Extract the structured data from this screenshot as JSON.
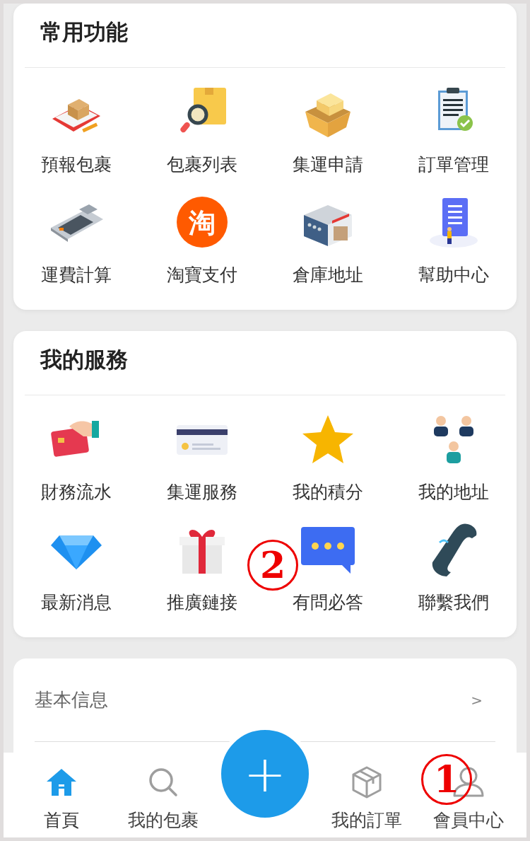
{
  "sections": [
    {
      "title": "常用功能",
      "items": [
        {
          "label": "預報包裹"
        },
        {
          "label": "包裹列表"
        },
        {
          "label": "集運申請"
        },
        {
          "label": "訂單管理"
        },
        {
          "label": "運費計算"
        },
        {
          "label": "淘寶支付"
        },
        {
          "label": "倉庫地址"
        },
        {
          "label": "幫助中心"
        }
      ]
    },
    {
      "title": "我的服務",
      "items": [
        {
          "label": "財務流水"
        },
        {
          "label": "集運服務"
        },
        {
          "label": "我的積分"
        },
        {
          "label": "我的地址"
        },
        {
          "label": "最新消息"
        },
        {
          "label": "推廣鏈接"
        },
        {
          "label": "有問必答"
        },
        {
          "label": "聯繫我們"
        }
      ]
    }
  ],
  "taobao_glyph": "淘",
  "list": [
    {
      "label": "基本信息",
      "arrow": ">"
    }
  ],
  "bottom_nav": [
    {
      "label": "首頁",
      "selected": true
    },
    {
      "label": "我的包裹",
      "selected": false
    },
    {
      "kind": "fab",
      "symbol": "+"
    },
    {
      "label": "我的訂單",
      "selected": false
    },
    {
      "label": "會員中心",
      "selected": false
    }
  ],
  "callouts": [
    {
      "label": "2"
    },
    {
      "label": "1"
    }
  ]
}
